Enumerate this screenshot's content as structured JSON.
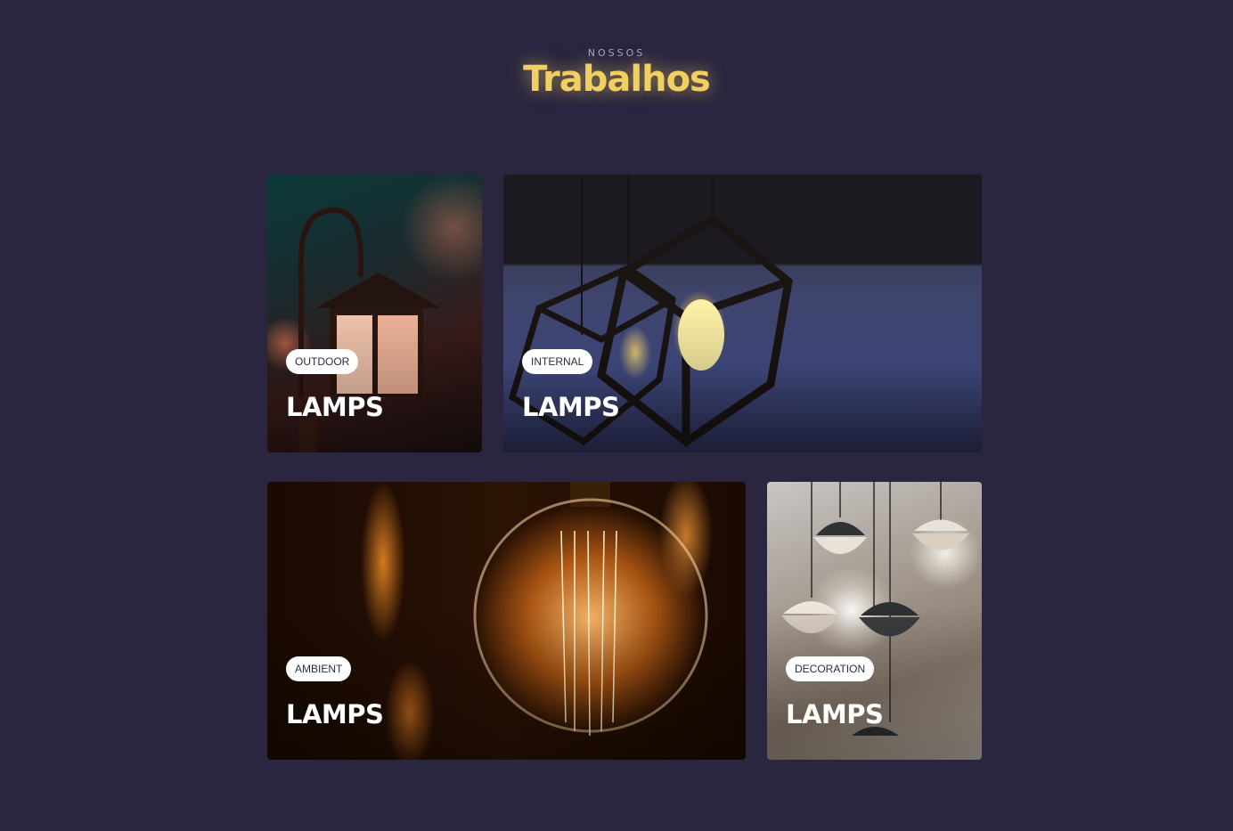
{
  "header": {
    "eyebrow": "NOSSOS",
    "title": "Trabalhos"
  },
  "colors": {
    "background": "#2a2640",
    "title": "#f2cf63",
    "eyebrow": "#a8a4c8",
    "tag_background": "#ffffff",
    "tag_text": "#2c2a45",
    "card_title": "#ffffff"
  },
  "cards": [
    {
      "tag": "OUTDOOR",
      "title": "LAMPS",
      "image": "lantern-photo"
    },
    {
      "tag": "INTERNAL",
      "title": "LAMPS",
      "image": "geometric-pendant-photo"
    },
    {
      "tag": "AMBIENT",
      "title": "LAMPS",
      "image": "edison-bulb-photo"
    },
    {
      "tag": "DECORATION",
      "title": "LAMPS",
      "image": "pendant-lamps-photo"
    }
  ]
}
